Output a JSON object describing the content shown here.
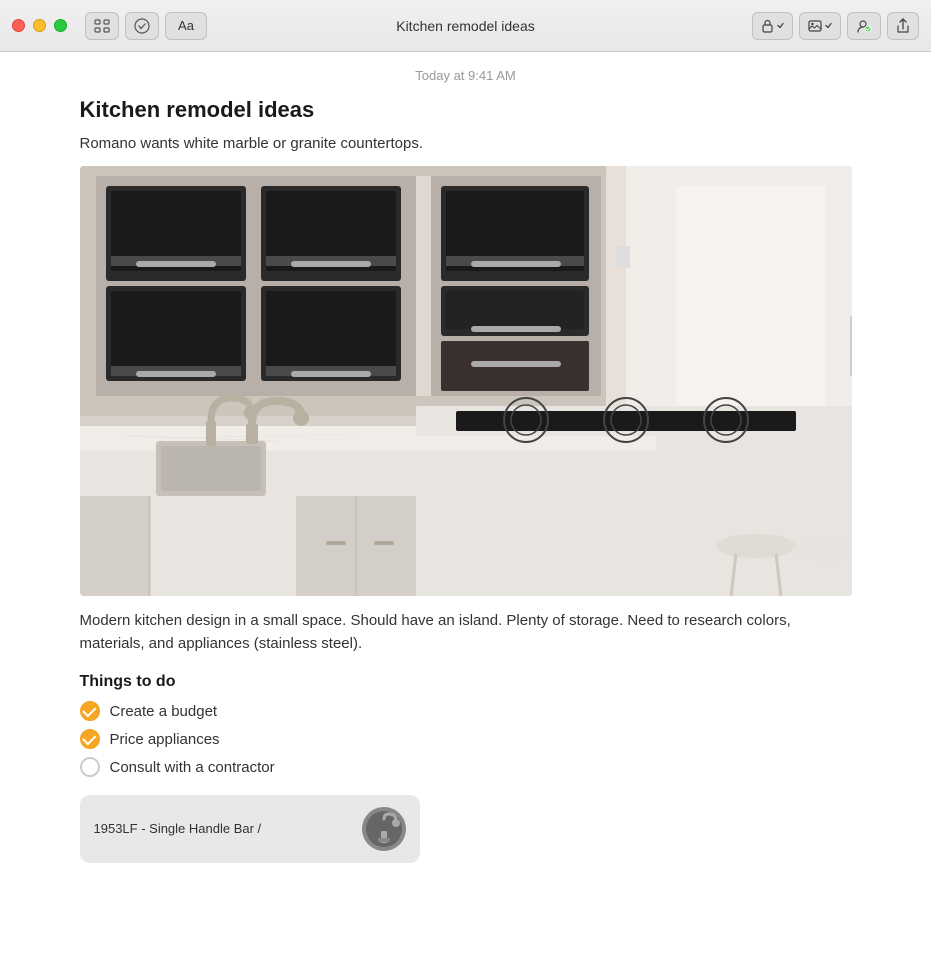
{
  "titlebar": {
    "title": "Kitchen remodel ideas",
    "traffic_lights": [
      "close",
      "minimize",
      "maximize"
    ],
    "toolbar": {
      "grid_icon_label": "⊞",
      "check_icon_label": "✓",
      "font_label": "Aa"
    },
    "right_buttons": {
      "lock_label": "🔒",
      "image_label": "🖼",
      "collab_label": "👤",
      "share_label": "↑"
    }
  },
  "note": {
    "timestamp": "Today at 9:41 AM",
    "title": "Kitchen remodel ideas",
    "subtitle": "Romano wants white marble or granite countertops.",
    "description": "Modern kitchen design in a small space. Should have an island. Plenty of storage. Need to research colors, materials, and appliances (stainless steel).",
    "section_heading": "Things to do",
    "checklist": [
      {
        "text": "Create a budget",
        "checked": true
      },
      {
        "text": "Price appliances",
        "checked": true
      },
      {
        "text": "Consult with a contractor",
        "checked": false
      }
    ],
    "bottom_card_text": "1953LF - Single Handle Bar /"
  }
}
